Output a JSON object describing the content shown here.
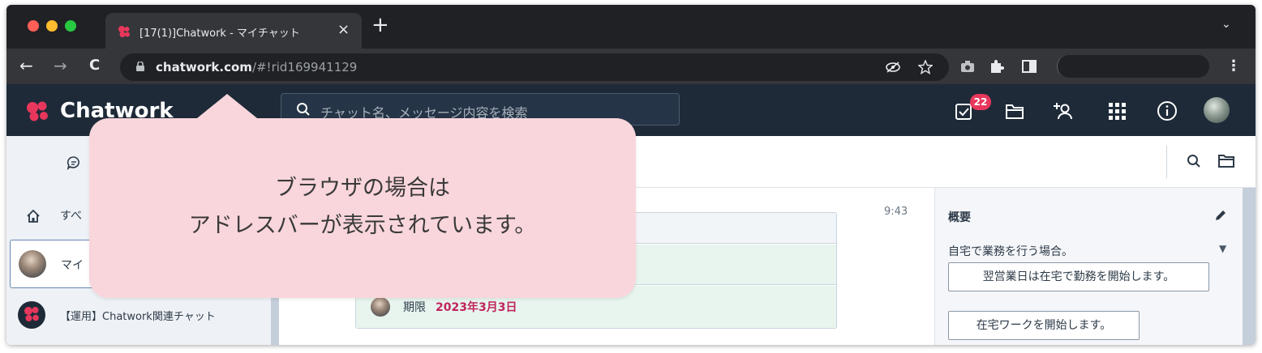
{
  "browser": {
    "tab_title": "[17(1)]Chatwork - マイチャット",
    "tab_close": "×",
    "new_tab": "+",
    "tab_list": "⌄",
    "back": "←",
    "forward": "→",
    "reload": "C",
    "url_host": "chatwork.com",
    "url_path": "/#!rid169941129",
    "menu": "⋮"
  },
  "app": {
    "logo_text": "Chatwork",
    "search_placeholder": "チャット名、メッセージ内容を検索",
    "task_badge": "22"
  },
  "sidebar": {
    "all_label": "すべ",
    "selected_item": "マイ",
    "item2": "【運用】Chatwork関連チャット"
  },
  "main": {
    "time": "9:43",
    "due_label": "期限",
    "due_date": "2023年3月3日"
  },
  "right_pane": {
    "title": "概要",
    "description": "自宅で業務を行う場合。",
    "button1": "翌営業日は在宅で勤務を開始します。",
    "button2": "在宅ワークを開始します。",
    "caret": "▼"
  },
  "callout": {
    "line1": "ブラウザの場合は",
    "line2": "アドレスバーが表示されています。"
  }
}
